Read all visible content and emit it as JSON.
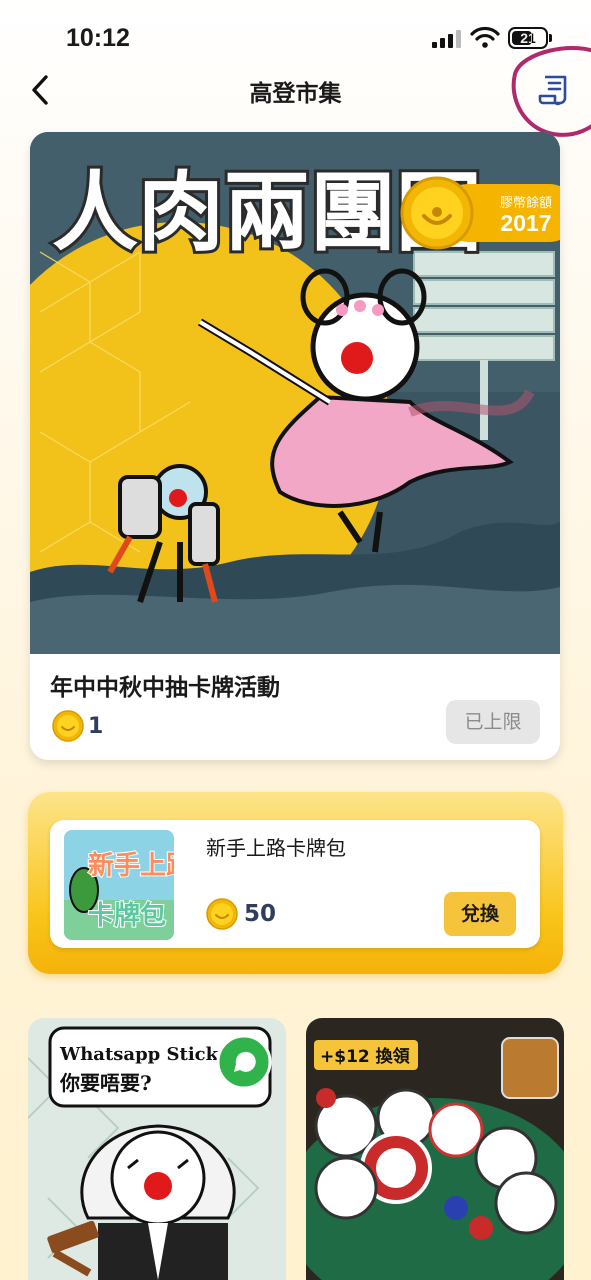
{
  "status": {
    "time": "10:12",
    "battery": "21"
  },
  "nav": {
    "title": "高登市集"
  },
  "hero": {
    "art_title": "人肉兩團圓",
    "title": "年中中秋中抽卡牌活動",
    "price": "1",
    "status_label": "已上限",
    "balance_label": "膠幣餘額",
    "balance_value": "2017"
  },
  "featured": {
    "name": "新手上路卡牌包",
    "thumb_text_line1": "新手上路",
    "thumb_text_line2": "卡牌包",
    "price": "50",
    "action": "兌換"
  },
  "tiles": [
    {
      "line1": "Whatsapp Sticker",
      "line2": "你要唔要?"
    },
    {
      "badge": "+$12 換領"
    }
  ],
  "colors": {
    "accent": "#f5b400",
    "coin": "#f7c500",
    "price_text": "#2f3d5e"
  }
}
